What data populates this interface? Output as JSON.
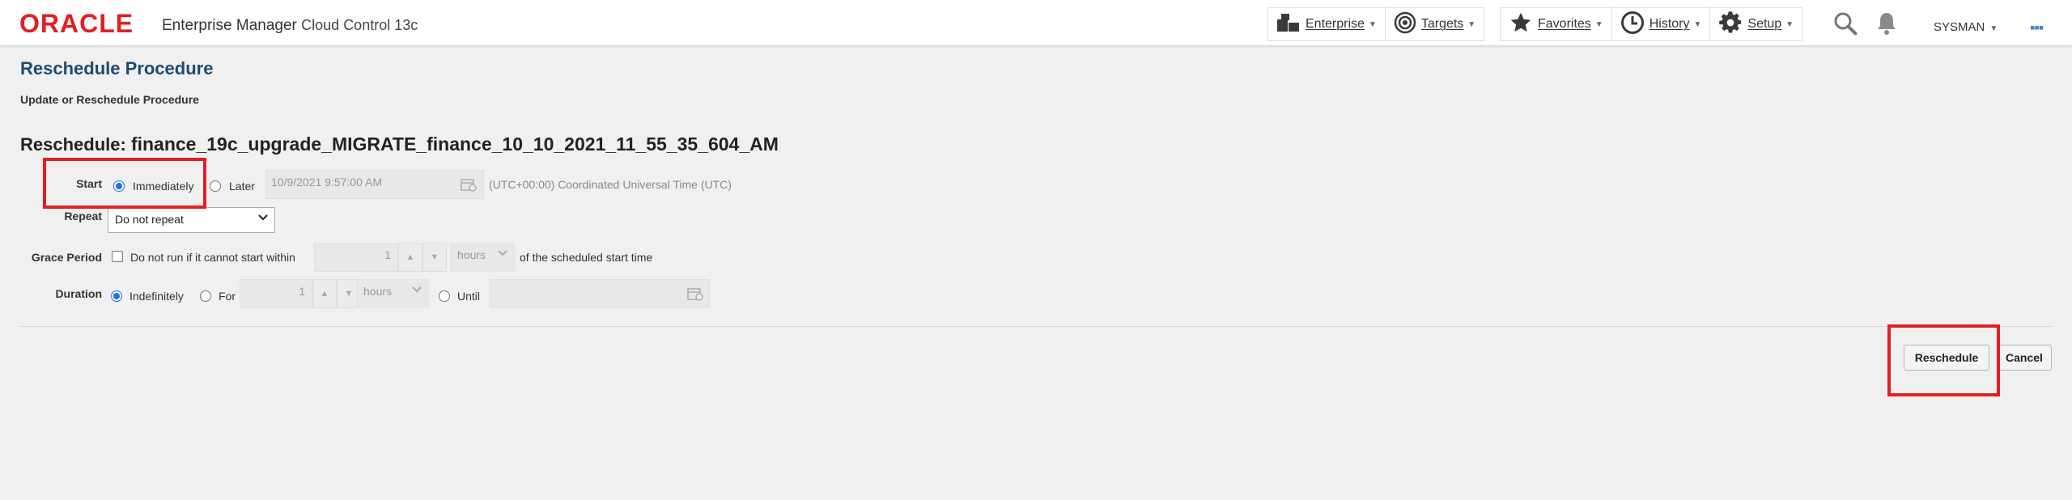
{
  "header": {
    "logo": "ORACLE",
    "product_name": "Enterprise Manager",
    "product_edition": "Cloud Control 13c",
    "nav": [
      {
        "label": "Enterprise",
        "icon": "enterprise-icon"
      },
      {
        "label": "Targets",
        "icon": "targets-icon"
      },
      {
        "label": "Favorites",
        "icon": "star-icon"
      },
      {
        "label": "History",
        "icon": "clock-icon"
      },
      {
        "label": "Setup",
        "icon": "gear-icon"
      }
    ],
    "user": "SYSMAN"
  },
  "page": {
    "title": "Reschedule Procedure",
    "subtitle": "Update or Reschedule Procedure",
    "reschedule_label": "Reschedule:",
    "procedure_name": "finance_19c_upgrade_MIGRATE_finance_10_10_2021_11_55_35_604_AM"
  },
  "form": {
    "start": {
      "label": "Start",
      "immediately": "Immediately",
      "later": "Later",
      "date_value": "10/9/2021 9:57:00 AM",
      "timezone": "(UTC+00:00) Coordinated Universal Time (UTC)",
      "selected": "Immediately"
    },
    "repeat": {
      "label": "Repeat",
      "value": "Do not repeat"
    },
    "grace": {
      "label": "Grace Period",
      "checkbox_text": "Do not run if it cannot start within",
      "value": "1",
      "unit": "hours",
      "suffix": "of the scheduled start time",
      "checked": false
    },
    "duration": {
      "label": "Duration",
      "indefinitely": "Indefinitely",
      "for": "For",
      "for_value": "1",
      "for_unit": "hours",
      "until": "Until",
      "selected": "Indefinitely"
    }
  },
  "actions": {
    "reschedule": "Reschedule",
    "cancel": "Cancel"
  },
  "colors": {
    "brand_red": "#e31e24",
    "title_blue": "#1f4a6e",
    "highlight": "#e31e24"
  }
}
